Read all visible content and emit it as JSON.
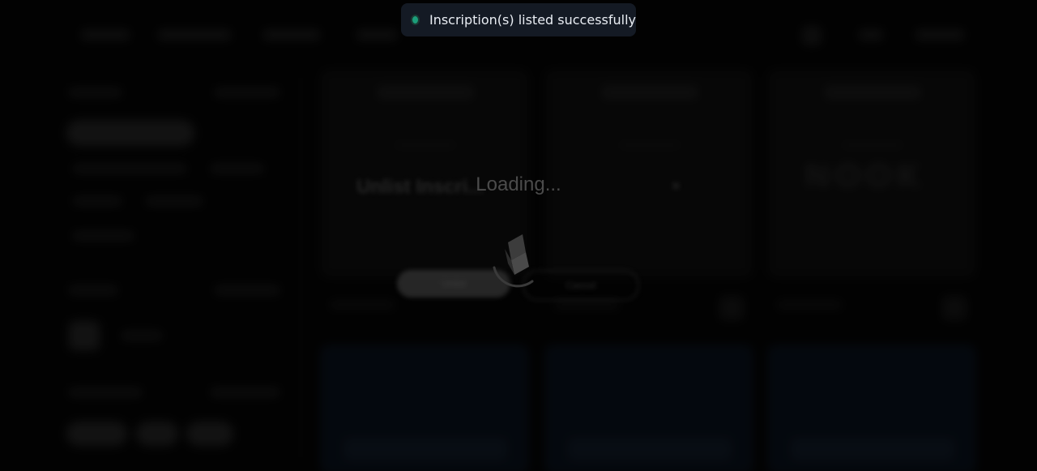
{
  "toast": {
    "message": "Inscription(s) listed successfully",
    "status_color": "#1c9e7b",
    "icon": "success-dot-icon"
  },
  "loader": {
    "text": "Loading..."
  },
  "modal": {
    "title": "Unlist Inscri...",
    "close_icon": "×",
    "confirm_label": "Unlist",
    "cancel_label": "Cancel"
  },
  "cards": {
    "third_card_text": "NOOK"
  }
}
